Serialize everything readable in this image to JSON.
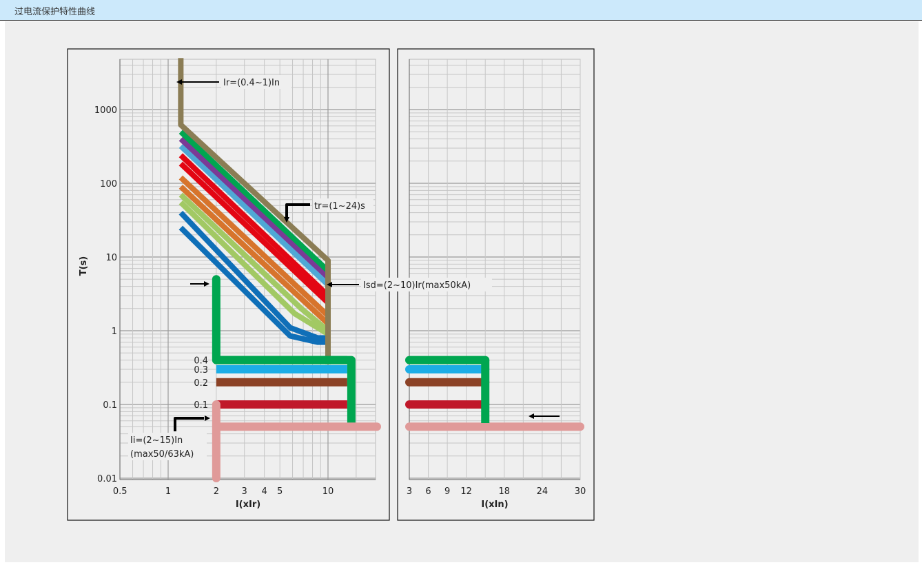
{
  "header": {
    "title": "过电流保护特性曲线"
  },
  "chart_data": [
    {
      "type": "line",
      "x_scale": "log",
      "y_scale": "log",
      "xlabel": "I(xIr)",
      "ylabel": "T(s)",
      "xticks": [
        "0.5",
        "1",
        "2",
        "3",
        "4",
        "5",
        "10"
      ],
      "yticks": [
        "0.01",
        "0.1",
        "1",
        "10",
        "100",
        "1000"
      ],
      "series": [
        {
          "color": "#8b7d55",
          "points": [
            [
              1.2,
              5000
            ],
            [
              1.2,
              620
            ],
            [
              10,
              9
            ],
            [
              10,
              0.35
            ]
          ]
        },
        {
          "color": "#00a650",
          "points": [
            [
              1.2,
              500
            ],
            [
              10,
              6.5
            ]
          ]
        },
        {
          "color": "#7b3a96",
          "points": [
            [
              1.2,
              400
            ],
            [
              10,
              5.3
            ]
          ]
        },
        {
          "color": "#4fa8d5",
          "points": [
            [
              1.2,
              320
            ],
            [
              10,
              4.2
            ]
          ]
        },
        {
          "color": "#e30613",
          "points": [
            [
              1.2,
              240
            ],
            [
              10,
              3.0
            ]
          ]
        },
        {
          "color": "#e30613",
          "points": [
            [
              1.2,
              185
            ],
            [
              10,
              2.4
            ]
          ]
        },
        {
          "color": "#d7742c",
          "points": [
            [
              1.2,
              120
            ],
            [
              10,
              1.6
            ]
          ]
        },
        {
          "color": "#d7742c",
          "points": [
            [
              1.2,
              90
            ],
            [
              10,
              1.25
            ]
          ]
        },
        {
          "color": "#a2c964",
          "points": [
            [
              1.2,
              70
            ],
            [
              6.8,
              2.0
            ],
            [
              10,
              1.0
            ]
          ]
        },
        {
          "color": "#a2c964",
          "points": [
            [
              1.2,
              55
            ],
            [
              6.2,
              1.7
            ],
            [
              10,
              0.9
            ]
          ]
        },
        {
          "color": "#0f6fb8",
          "points": [
            [
              1.2,
              40
            ],
            [
              5.8,
              1.1
            ],
            [
              8.6,
              0.8
            ],
            [
              10,
              0.8
            ]
          ]
        },
        {
          "color": "#0f6fb8",
          "points": [
            [
              1.2,
              25
            ],
            [
              5.8,
              0.85
            ],
            [
              8.6,
              0.7
            ],
            [
              10,
              0.7
            ]
          ]
        }
      ],
      "short_time": [
        {
          "label": "0.4",
          "y": 0.4,
          "color": "#00a650"
        },
        {
          "label": "0.3",
          "y": 0.3,
          "color": "#1cade6"
        },
        {
          "label": "0.2",
          "y": 0.2,
          "color": "#8b4226"
        },
        {
          "label": "0.1",
          "y": 0.1,
          "color": "#c0182a"
        }
      ],
      "short_time_vertical": {
        "x": 2,
        "y_top": 5,
        "color": "#00a650"
      },
      "short_time_end_x": 14,
      "instantaneous": {
        "x": 2,
        "y_bottom": 0.01,
        "y_top": 0.1,
        "y_flat": 0.05,
        "x_end": 21,
        "color": "#e09a99"
      },
      "annotations": [
        {
          "text": "Ir=(0.4~1)In"
        },
        {
          "text": "tr=(1~24)s"
        },
        {
          "text": "Isd=(2~10)Ir(max50kA)"
        },
        {
          "text": "Ii=(2~15)In"
        },
        {
          "text": "(max50/63kA)"
        }
      ]
    },
    {
      "type": "line",
      "x_scale": "linear",
      "y_scale": "log",
      "xlabel": "I(xIn)",
      "xticks": [
        "3",
        "6",
        "9",
        "12",
        "18",
        "24",
        "30"
      ],
      "series": [
        {
          "y": 0.4,
          "color": "#00a650"
        },
        {
          "y": 0.3,
          "color": "#1cade6"
        },
        {
          "y": 0.2,
          "color": "#8b4226"
        },
        {
          "y": 0.1,
          "color": "#c0182a"
        },
        {
          "y": 0.05,
          "color": "#e09a99"
        }
      ],
      "vertical_green_x": 15
    }
  ]
}
